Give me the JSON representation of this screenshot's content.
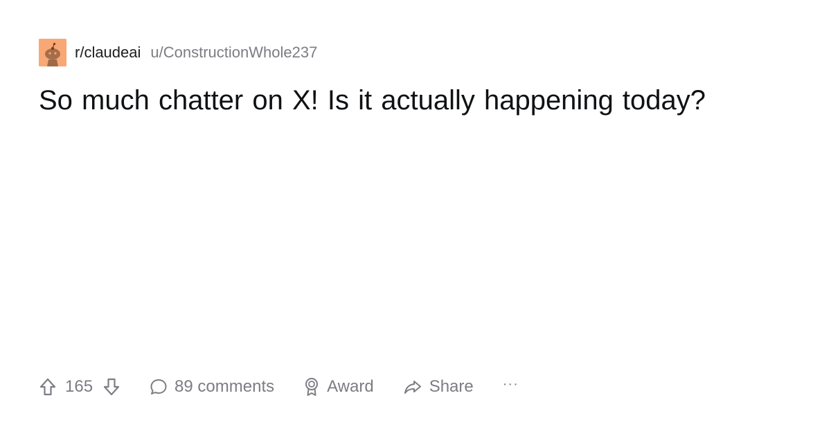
{
  "post": {
    "subreddit": "r/claudeai",
    "author": "u/ConstructionWhole237",
    "title": "So much chatter on X! Is it actually happening today?"
  },
  "actions": {
    "vote_count": "165",
    "comments_label": "89 comments",
    "award_label": "Award",
    "share_label": "Share",
    "more_label": "···"
  },
  "colors": {
    "avatar_bg": "#f8a874",
    "meta_text": "#7c7c83",
    "title_text": "#0f1113"
  }
}
